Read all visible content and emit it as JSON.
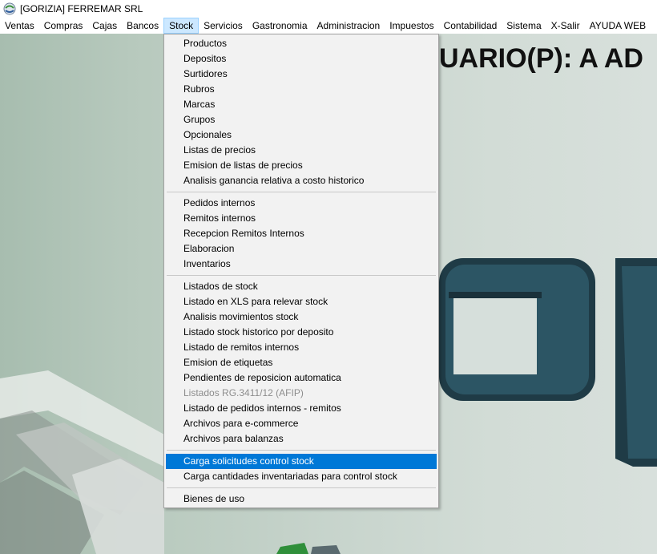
{
  "window": {
    "title": "[GORIZIA] FERREMAR SRL",
    "icon": "app-logo-icon"
  },
  "menubar": {
    "items": [
      {
        "label": "Ventas"
      },
      {
        "label": "Compras"
      },
      {
        "label": "Cajas"
      },
      {
        "label": "Bancos"
      },
      {
        "label": "Stock",
        "active": true
      },
      {
        "label": "Servicios"
      },
      {
        "label": "Gastronomia"
      },
      {
        "label": "Administracion"
      },
      {
        "label": "Impuestos"
      },
      {
        "label": "Contabilidad"
      },
      {
        "label": "Sistema"
      },
      {
        "label": "X-Salir"
      },
      {
        "label": "AYUDA WEB"
      }
    ]
  },
  "background": {
    "banner_text": "UARIO(P): A AD"
  },
  "stock_menu": {
    "groups": [
      {
        "items": [
          {
            "label": "Productos"
          },
          {
            "label": "Depositos"
          },
          {
            "label": "Surtidores"
          },
          {
            "label": "Rubros"
          },
          {
            "label": "Marcas"
          },
          {
            "label": "Grupos"
          },
          {
            "label": "Opcionales"
          },
          {
            "label": "Listas de precios"
          },
          {
            "label": "Emision de listas de precios"
          },
          {
            "label": "Analisis ganancia relativa a costo historico"
          }
        ]
      },
      {
        "items": [
          {
            "label": "Pedidos internos"
          },
          {
            "label": "Remitos internos"
          },
          {
            "label": "Recepcion Remitos Internos"
          },
          {
            "label": "Elaboracion"
          },
          {
            "label": "Inventarios"
          }
        ]
      },
      {
        "items": [
          {
            "label": "Listados de stock"
          },
          {
            "label": "Listado en XLS para relevar stock"
          },
          {
            "label": "Analisis movimientos stock"
          },
          {
            "label": "Listado stock historico por  deposito"
          },
          {
            "label": "Listado de remitos internos"
          },
          {
            "label": "Emision de etiquetas"
          },
          {
            "label": "Pendientes de reposicion automatica"
          },
          {
            "label": "Listados RG.3411/12 (AFIP)",
            "disabled": true
          },
          {
            "label": "Listado de pedidos internos - remitos"
          },
          {
            "label": "Archivos para e-commerce"
          },
          {
            "label": "Archivos para balanzas"
          }
        ]
      },
      {
        "items": [
          {
            "label": "Carga solicitudes control stock",
            "highlighted": true
          },
          {
            "label": "Carga cantidades inventariadas para control stock"
          }
        ]
      },
      {
        "items": [
          {
            "label": "Bienes de uso"
          }
        ]
      }
    ]
  },
  "colors": {
    "highlight": "#0078d7",
    "menu_bg": "#f2f2f2",
    "active_menu_bg": "#cce8ff",
    "disabled_text": "#8d8d8d"
  }
}
